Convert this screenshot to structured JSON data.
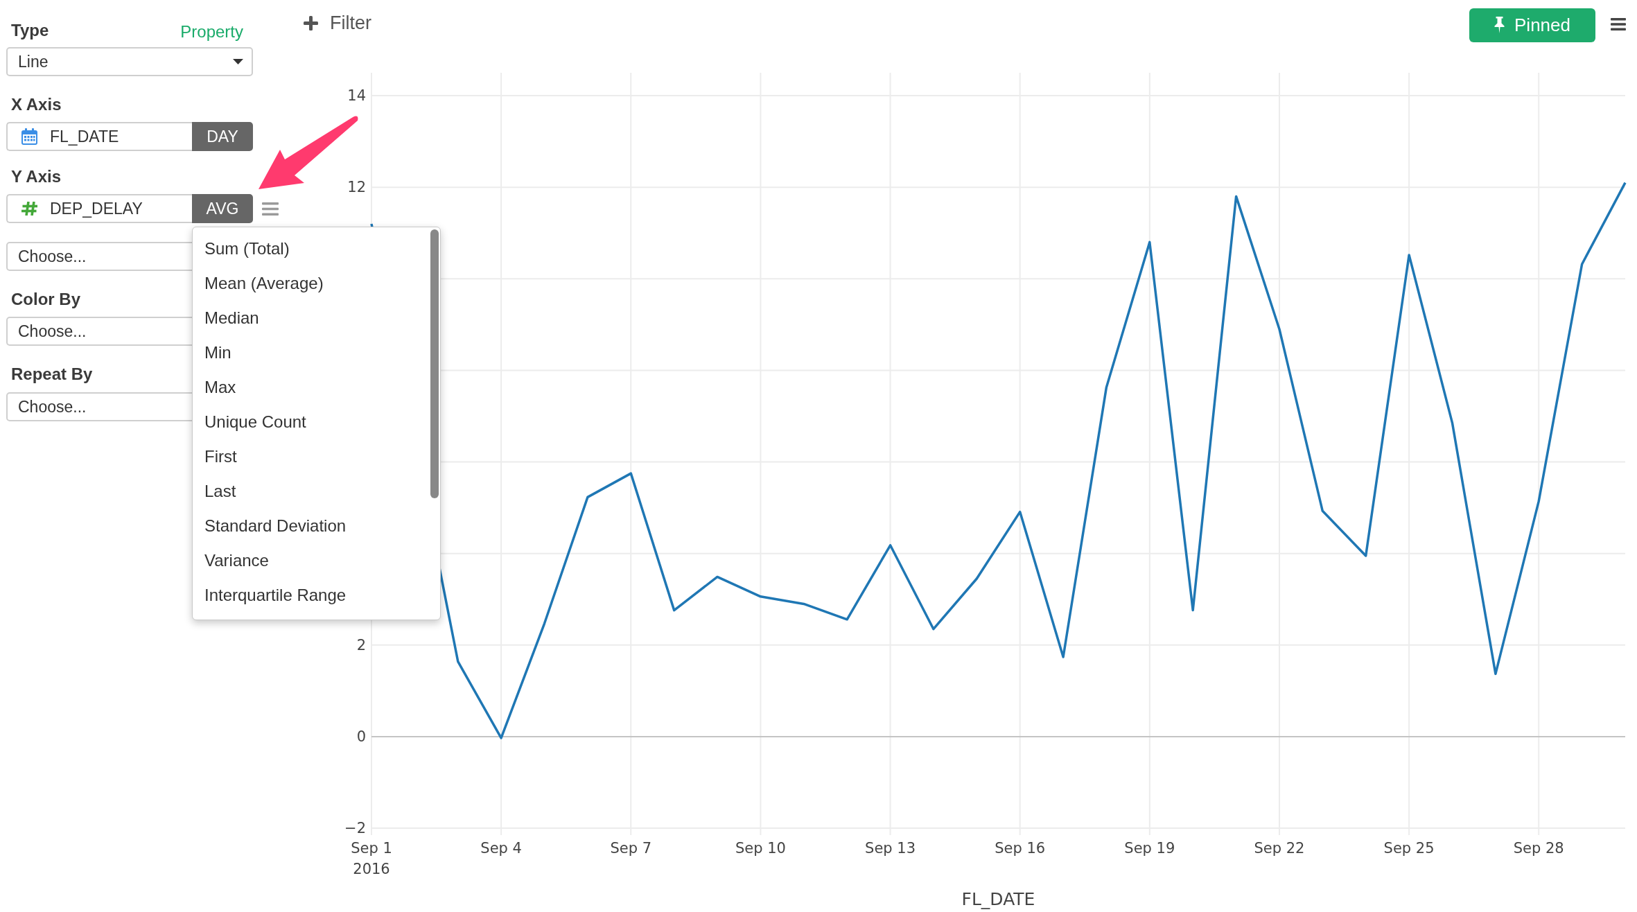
{
  "toolbar": {
    "filter": "Filter",
    "pin": "Pinned"
  },
  "sidebar": {
    "type": {
      "label": "Type",
      "link": "Property",
      "value": "Line"
    },
    "x_axis": {
      "label": "X Axis",
      "column": {
        "kind": "date",
        "name": "FL_DATE"
      },
      "aggregation": "DAY"
    },
    "y_axis": {
      "label": "Y Axis",
      "column": {
        "kind": "number",
        "name": "DEP_DELAY"
      },
      "aggregation": "AVG",
      "add_column": {
        "placeholder": "Choose..."
      }
    },
    "color_by": {
      "label": "Color By",
      "placeholder": "Choose..."
    },
    "repeat_by": {
      "label": "Repeat By",
      "placeholder": "Choose..."
    }
  },
  "aggregation_menu": {
    "items": [
      "Sum (Total)",
      "Mean (Average)",
      "Median",
      "Min",
      "Max",
      "Unique Count",
      "First",
      "Last",
      "Standard Deviation",
      "Variance",
      "Interquartile Range"
    ]
  },
  "chart": {
    "chart_data": {
      "type": "line",
      "xlabel": "FL_DATE",
      "categories": [
        "Sep 1\n2016",
        null,
        null,
        "Sep 4",
        null,
        null,
        "Sep 7",
        null,
        null,
        "Sep 10",
        null,
        null,
        "Sep 13",
        null,
        null,
        "Sep 16",
        null,
        null,
        "Sep 19",
        null,
        null,
        "Sep 22",
        null,
        null,
        "Sep 25",
        null,
        null,
        "Sep 28",
        null,
        null
      ],
      "values": [
        11.2,
        null,
        1.64,
        -0.03,
        2.47,
        5.23,
        5.75,
        2.76,
        3.49,
        3.06,
        2.9,
        2.56,
        4.18,
        2.35,
        3.45,
        4.91,
        1.74,
        7.63,
        10.8,
        2.76,
        11.8,
        8.9,
        4.93,
        3.95,
        10.52,
        6.85,
        1.37,
        5.14,
        10.32,
        12.1
      ],
      "ylim": [
        -2.15,
        14.5
      ],
      "yticks": [
        {
          "value": -2,
          "label": "−2"
        },
        0,
        2,
        12,
        14
      ],
      "grid": true
    }
  }
}
